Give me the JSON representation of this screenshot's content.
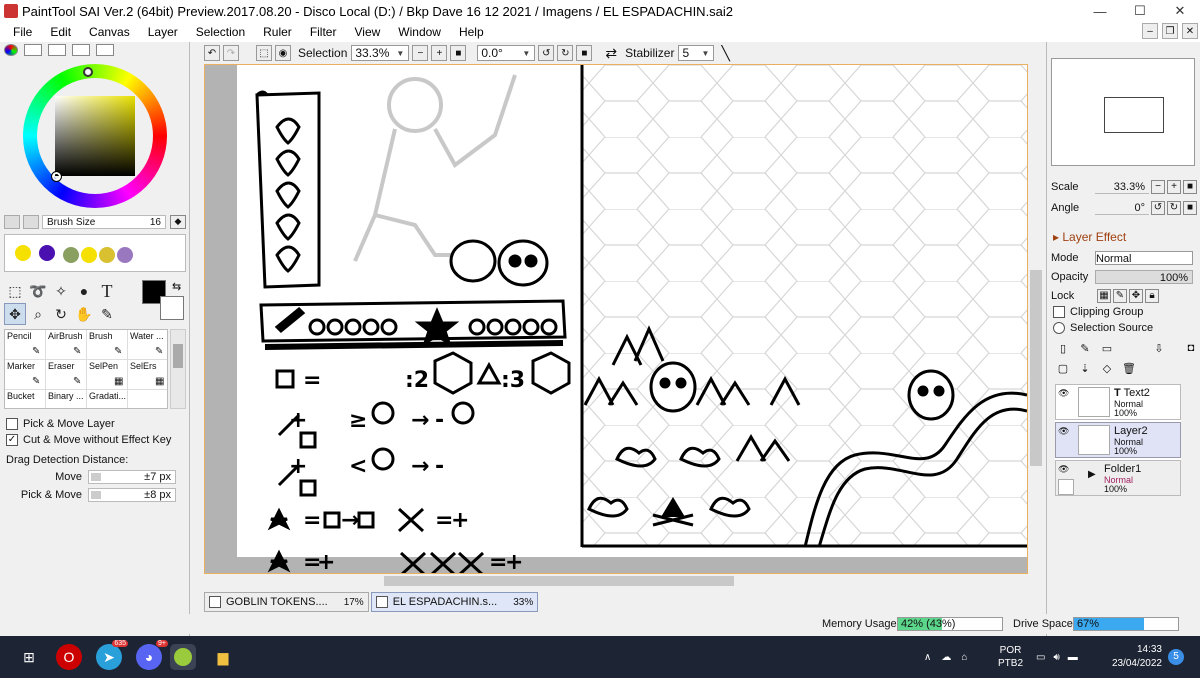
{
  "window": {
    "title": "PaintTool SAI Ver.2 (64bit) Preview.2017.08.20 - Disco Local (D:) / Bkp Dave 16 12 2021 / Imagens / EL ESPADACHIN.sai2",
    "minimize": "—",
    "maximize": "☐",
    "close": "✕"
  },
  "menu": [
    "File",
    "Edit",
    "Canvas",
    "Layer",
    "Selection",
    "Ruler",
    "Filter",
    "View",
    "Window",
    "Help"
  ],
  "toolbar": {
    "selection_label": "Selection",
    "zoom_value": "33.3%",
    "angle_value": "0.0°",
    "stabilizer_label": "Stabilizer",
    "stabilizer_value": "5"
  },
  "left_panel": {
    "brush_size_label": "Brush Size",
    "brush_size_value": "16",
    "palette_colors": [
      "#f5e000",
      "#4a10b0",
      "#8aa060",
      "#f5e000",
      "#d8c030",
      "#9a78c0"
    ],
    "fg_color": "#000000",
    "bg_color": "#ffffff",
    "brushes": [
      "Pencil",
      "AirBrush",
      "Brush",
      "Water ...",
      "Marker",
      "Eraser",
      "SelPen",
      "SelErs",
      "Bucket",
      "Binary ...",
      "Gradati..."
    ],
    "pick_move_layer": "Pick & Move Layer",
    "cut_move": "Cut & Move without Effect Key",
    "drag_title": "Drag Detection Distance:",
    "move_label": "Move",
    "move_value": "±7 px",
    "pickmove_label": "Pick & Move",
    "pickmove_value": "±8 px"
  },
  "right_panel": {
    "scale_label": "Scale",
    "scale_value": "33.3%",
    "angle_label": "Angle",
    "angle_value": "0°",
    "layer_effect": "Layer Effect",
    "mode_label": "Mode",
    "mode_value": "Normal",
    "opacity_label": "Opacity",
    "opacity_value": "100%",
    "lock_label": "Lock",
    "clipping_group": "Clipping Group",
    "selection_source": "Selection Source",
    "layers": [
      {
        "name": "Text2",
        "mode": "Normal",
        "opacity": "100%"
      },
      {
        "name": "Layer2",
        "mode": "Normal",
        "opacity": "100%"
      },
      {
        "name": "Folder1",
        "mode": "Normal",
        "opacity": "100%"
      }
    ]
  },
  "doc_tabs": [
    {
      "name": "GOBLIN TOKENS....",
      "zoom": "17%"
    },
    {
      "name": "EL ESPADACHIN.s...",
      "zoom": "33%"
    }
  ],
  "status": {
    "memory_label": "Memory Usage",
    "memory_value": "42% (43%)",
    "memory_fraction": 0.42,
    "drive_label": "Drive Space",
    "drive_value": "67%",
    "drive_fraction": 0.67
  },
  "canvas": {
    "token_line1": "=",
    "token_line1_b": ":2",
    "token_line1_c": ":3",
    "row_plus": "+",
    "cmp_ge": "≥",
    "cmp_lt": "<",
    "arrow": "→",
    "minus": "-"
  },
  "taskbar": {
    "telegram_badge": "635",
    "discord_badge": "9+",
    "lang_top": "POR",
    "lang_bottom": "PTB2",
    "time": "14:33",
    "date": "23/04/2022",
    "notification_count": "5"
  }
}
